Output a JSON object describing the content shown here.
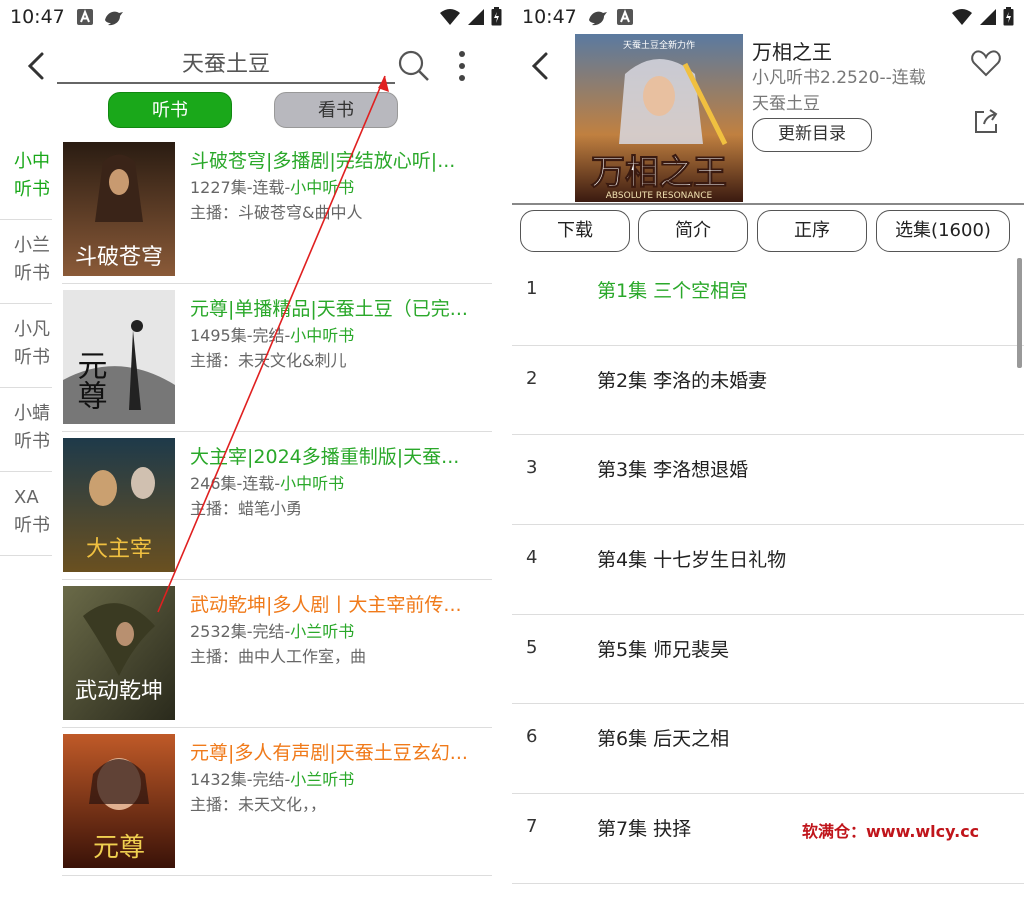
{
  "left": {
    "status": {
      "time": "10:47"
    },
    "search": {
      "value": "天蚕土豆"
    },
    "segments": {
      "listen": "听书",
      "read": "看书"
    },
    "sources": [
      {
        "label": "小中听书",
        "active": true
      },
      {
        "label": "小兰听书",
        "active": false
      },
      {
        "label": "小凡听书",
        "active": false
      },
      {
        "label": "小蜻听书",
        "active": false
      },
      {
        "label": "XA听书",
        "active": false
      }
    ],
    "books": [
      {
        "title": "斗破苍穹|多播剧|完结放心听|...",
        "meta": "1227集-连载-",
        "source": "小中听书",
        "host": "主播：斗破苍穹&曲中人",
        "color": "green",
        "cover_text": "斗破苍穹",
        "cover_bg": "#5a3b28"
      },
      {
        "title": "元尊|单播精品|天蚕土豆（已完...",
        "meta": "1495集-完结-",
        "source": "小中听书",
        "host": "主播：未天文化&刺儿",
        "color": "green",
        "cover_text": "元尊",
        "cover_bg": "#d8d8d8"
      },
      {
        "title": "大主宰|2024多播重制版|天蚕...",
        "meta": "246集-连载-",
        "source": "小中听书",
        "host": "主播：蜡笔小勇",
        "color": "green",
        "cover_text": "大主宰",
        "cover_bg": "#2a3b3a"
      },
      {
        "title": "武动乾坤|多人剧丨大主宰前传...",
        "meta": "2532集-完结-",
        "source": "小兰听书",
        "host": "主播：曲中人工作室，曲",
        "color": "orange",
        "cover_text": "武动乾坤",
        "cover_bg": "#4a4a30"
      },
      {
        "title": "元尊|多人有声剧|天蚕土豆玄幻...",
        "meta": "1432集-完结-",
        "source": "小兰听书",
        "host": "主播：未天文化，，",
        "color": "orange",
        "cover_text": "元尊",
        "cover_bg": "#7a2a18"
      }
    ]
  },
  "right": {
    "status": {
      "time": "10:47"
    },
    "detail": {
      "title": "万相之王",
      "subtitle": "小凡听书2.2520--连载",
      "author": "天蚕土豆",
      "cover_text": "万相之王",
      "cover_top": "天蚕土豆全新力作",
      "cover_sub": "ABSOLUTE RESONANCE",
      "update_label": "更新目录"
    },
    "tabs": {
      "download": "下载",
      "intro": "简介",
      "order": "正序",
      "select": "选集(1600)"
    },
    "episodes": [
      {
        "num": "1",
        "name": "第1集 三个空相宫",
        "active": true
      },
      {
        "num": "2",
        "name": "第2集 李洛的未婚妻",
        "active": false
      },
      {
        "num": "3",
        "name": "第3集 李洛想退婚",
        "active": false
      },
      {
        "num": "4",
        "name": "第4集 十七岁生日礼物",
        "active": false
      },
      {
        "num": "5",
        "name": "第5集 师兄裴昊",
        "active": false
      },
      {
        "num": "6",
        "name": "第6集 后天之相",
        "active": false
      },
      {
        "num": "7",
        "name": "第7集 抉择",
        "active": false
      }
    ],
    "watermark": "软满仓：www.wlcy.cc"
  },
  "colors": {
    "accent_green": "#1aa81a",
    "highlight_orange": "#f07a1a",
    "annotation_red": "#e02020"
  }
}
